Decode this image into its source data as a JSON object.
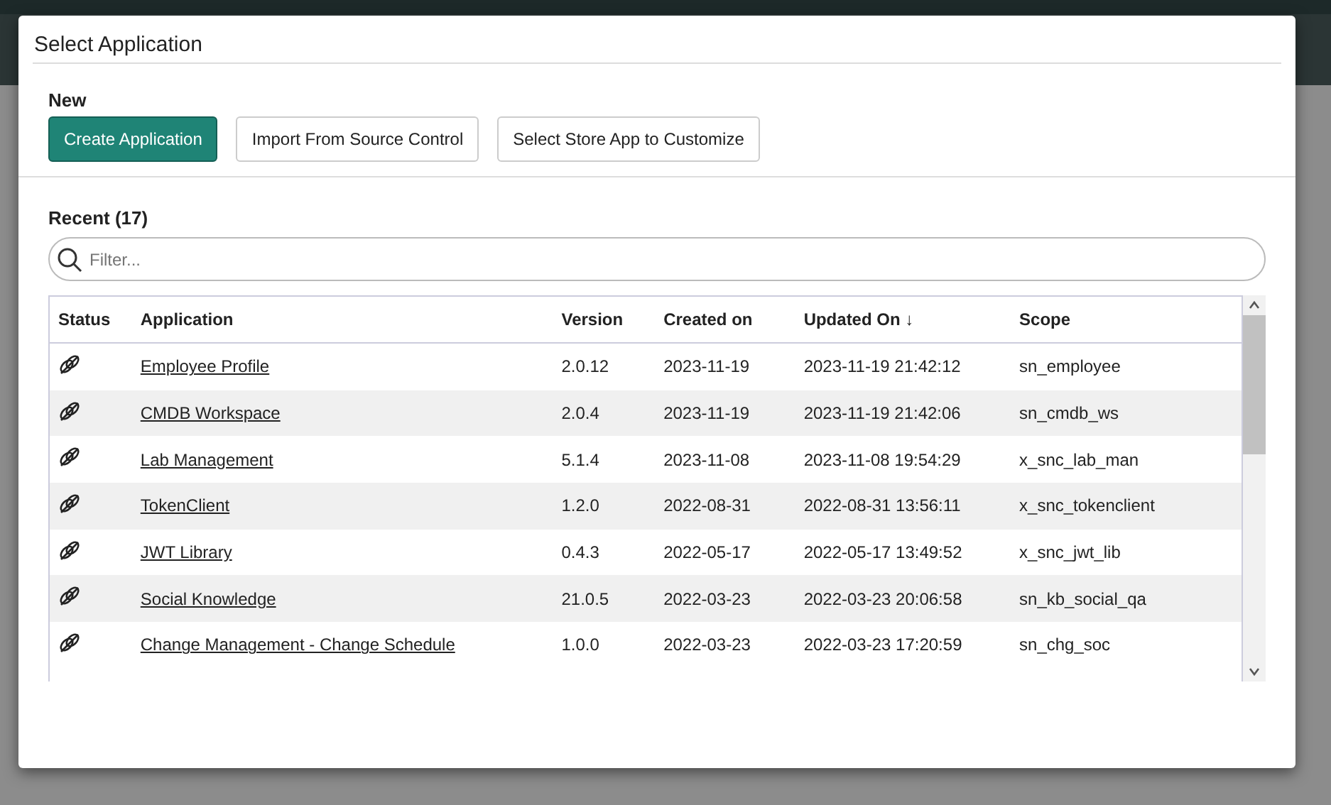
{
  "dialog": {
    "title": "Select Application"
  },
  "new_section": {
    "heading": "New",
    "buttons": [
      {
        "label": "Create Application",
        "kind": "primary"
      },
      {
        "label": "Import From Source Control",
        "kind": "secondary"
      },
      {
        "label": "Select Store App to Customize",
        "kind": "secondary"
      }
    ]
  },
  "recent_section": {
    "heading": "Recent (17)",
    "filter": {
      "placeholder": "Filter..."
    }
  },
  "table": {
    "columns": [
      {
        "label": "Status"
      },
      {
        "label": "Application"
      },
      {
        "label": "Version"
      },
      {
        "label": "Created on"
      },
      {
        "label": "Updated On",
        "sort_indicator": "↓"
      },
      {
        "label": "Scope"
      }
    ],
    "rows": [
      {
        "application": "Employee Profile",
        "version": "2.0.12",
        "created_on": "2023-11-19",
        "updated_on": "2023-11-19 21:42:12",
        "scope": "sn_employee"
      },
      {
        "application": "CMDB Workspace",
        "version": "2.0.4",
        "created_on": "2023-11-19",
        "updated_on": "2023-11-19 21:42:06",
        "scope": "sn_cmdb_ws"
      },
      {
        "application": "Lab Management",
        "version": "5.1.4",
        "created_on": "2023-11-08",
        "updated_on": "2023-11-08 19:54:29",
        "scope": "x_snc_lab_man"
      },
      {
        "application": "TokenClient",
        "version": "1.2.0",
        "created_on": "2022-08-31",
        "updated_on": "2022-08-31 13:56:11",
        "scope": "x_snc_tokenclient"
      },
      {
        "application": "JWT Library",
        "version": "0.4.3",
        "created_on": "2022-05-17",
        "updated_on": "2022-05-17 13:49:52",
        "scope": "x_snc_jwt_lib"
      },
      {
        "application": "Social Knowledge",
        "version": "21.0.5",
        "created_on": "2022-03-23",
        "updated_on": "2022-03-23 20:06:58",
        "scope": "sn_kb_social_qa"
      },
      {
        "application": "Change Management - Change Schedule",
        "version": "1.0.0",
        "created_on": "2022-03-23",
        "updated_on": "2022-03-23 17:20:59",
        "scope": "sn_chg_soc"
      }
    ]
  }
}
